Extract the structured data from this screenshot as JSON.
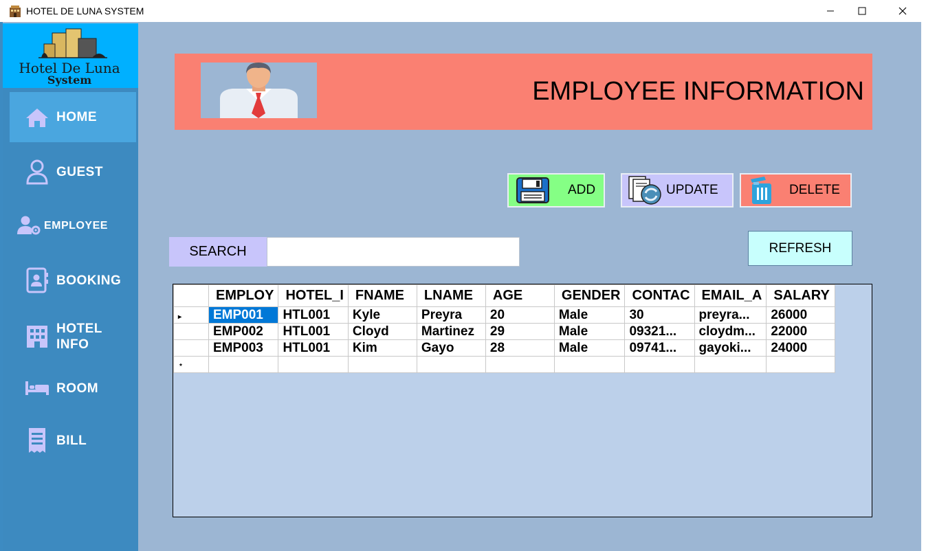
{
  "window": {
    "title": "HOTEL DE LUNA SYSTEM"
  },
  "sidebar": {
    "logo_line1": "Hotel De Luna",
    "logo_line2": "System",
    "items": [
      {
        "label": "HOME",
        "icon": "home-icon"
      },
      {
        "label": "GUEST",
        "icon": "user-icon"
      },
      {
        "label": "EMPLOYEE",
        "icon": "user-gear-icon"
      },
      {
        "label": "BOOKING",
        "icon": "contact-book-icon"
      },
      {
        "label": "HOTEL",
        "label2": "INFO",
        "icon": "building-icon"
      },
      {
        "label": "ROOM",
        "icon": "bed-icon"
      },
      {
        "label": "BILL",
        "icon": "receipt-icon"
      }
    ]
  },
  "header": {
    "title": "EMPLOYEE INFORMATION"
  },
  "actions": {
    "add_label": "ADD",
    "update_label": "UPDATE",
    "delete_label": "DELETE",
    "refresh_label": "REFRESH"
  },
  "search": {
    "label": "SEARCH",
    "value": ""
  },
  "grid": {
    "columns": [
      "EMPLOY",
      "HOTEL_I",
      "FNAME",
      "LNAME",
      "AGE",
      "GENDER",
      "CONTAC",
      "EMAIL_A",
      "SALARY"
    ],
    "rows": [
      [
        "EMP001",
        "HTL001",
        "Kyle",
        "Preyra",
        "20",
        "Male",
        "30",
        "preyra...",
        "26000"
      ],
      [
        "EMP002",
        "HTL001",
        "Cloyd",
        "Martinez",
        "29",
        "Male",
        "09321...",
        "cloydm...",
        "22000"
      ],
      [
        "EMP003",
        "HTL001",
        "Kim",
        "Gayo",
        "28",
        "Male",
        "09741...",
        "gayoki...",
        "24000"
      ]
    ],
    "current_row_marker": "▸",
    "new_row_marker": "*"
  },
  "colors": {
    "sidebar": "#3d8ac0",
    "logo_bg": "#00b0ff",
    "content_bg": "#9cb6d3",
    "banner": "#fa8072",
    "add": "#85ff85",
    "update": "#c8c5fb",
    "delete": "#fa8072",
    "refresh": "#c8fffd",
    "selection": "#0078d7"
  }
}
